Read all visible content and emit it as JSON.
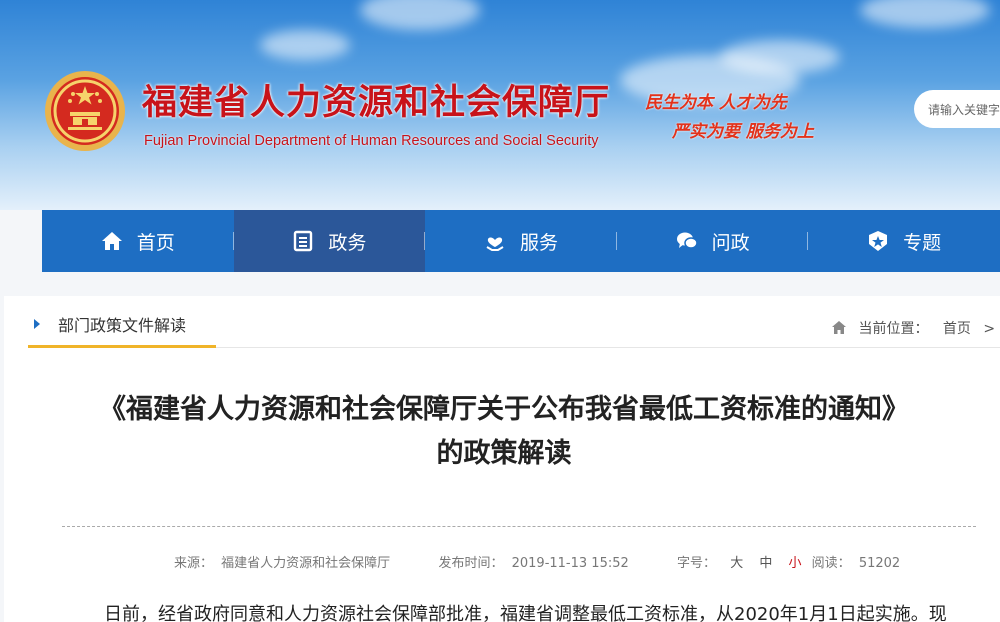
{
  "header": {
    "title_cn": "福建省人力资源和社会保障厅",
    "title_en": "Fujian Provincial Department of Human Resources and Social Security",
    "slogan_line1": "民生为本  人才为先",
    "slogan_line2": "严实为要  服务为上",
    "search_placeholder": "请输入关键字"
  },
  "nav": {
    "items": [
      {
        "label": "首页",
        "icon": "home-icon"
      },
      {
        "label": "政务",
        "icon": "document-icon",
        "active": true
      },
      {
        "label": "服务",
        "icon": "heart-hand-icon"
      },
      {
        "label": "问政",
        "icon": "chat-icon"
      },
      {
        "label": "专题",
        "icon": "star-badge-icon"
      }
    ]
  },
  "section": {
    "title": "部门政策文件解读",
    "location_label": "当前位置：",
    "location_home": "首页",
    "location_sep": ">"
  },
  "article": {
    "title_line1": "《福建省人力资源和社会保障厅关于公布我省最低工资标准的通知》",
    "title_line2": "的政策解读",
    "source_label": "来源：",
    "source": "福建省人力资源和社会保障厅",
    "published_label": "发布时间：",
    "published": "2019-11-13 15:52",
    "font_label": "字号：",
    "font_large": "大",
    "font_medium": "中",
    "font_small": "小",
    "views_label": "阅读：",
    "views": "51202",
    "body_first_line": "日前，经省政府同意和人力资源社会保障部批准，福建省调整最低工资标准，从2020年1月1日起实施。现"
  },
  "colors": {
    "brand_red": "#c8131a",
    "nav_blue": "#1e6ec3",
    "nav_active": "#2b5799",
    "accent_gold": "#f0b429"
  }
}
